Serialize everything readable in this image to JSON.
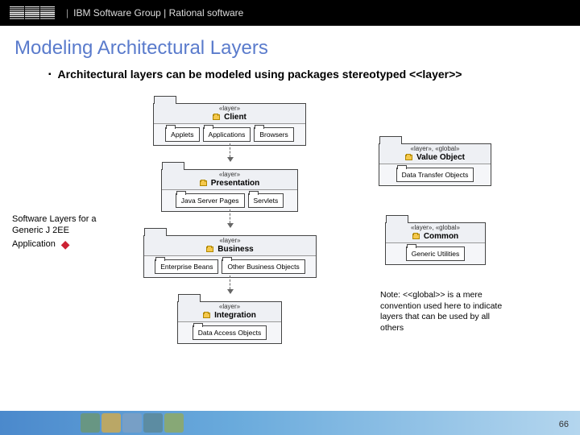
{
  "header": {
    "brand": "IBM",
    "text": "IBM Software Group | Rational software"
  },
  "title": "Modeling Architectural Layers",
  "bullet": "Architectural layers can be modeled using packages stereotyped <<layer>>",
  "layers": {
    "client": {
      "stereo": "«layer»",
      "name": "Client",
      "items": [
        "Applets",
        "Applications",
        "Browsers"
      ]
    },
    "presentation": {
      "stereo": "«layer»",
      "name": "Presentation",
      "items": [
        "Java Server Pages",
        "Servlets"
      ]
    },
    "business": {
      "stereo": "«layer»",
      "name": "Business",
      "items": [
        "Enterprise Beans",
        "Other Business Objects"
      ]
    },
    "integration": {
      "stereo": "«layer»",
      "name": "Integration",
      "items": [
        "Data Access Objects"
      ]
    },
    "valueobj": {
      "stereo": "«layer», «global»",
      "name": "Value Object",
      "items": [
        "Data Transfer Objects"
      ]
    },
    "common": {
      "stereo": "«layer», «global»",
      "name": "Common",
      "items": [
        "Generic Utilities"
      ]
    }
  },
  "caption_left": "Software Layers for a Generic J 2EE Application",
  "note_right": "Note: <<global>> is a mere convention used here to indicate layers that can be used by all others",
  "page": "66"
}
